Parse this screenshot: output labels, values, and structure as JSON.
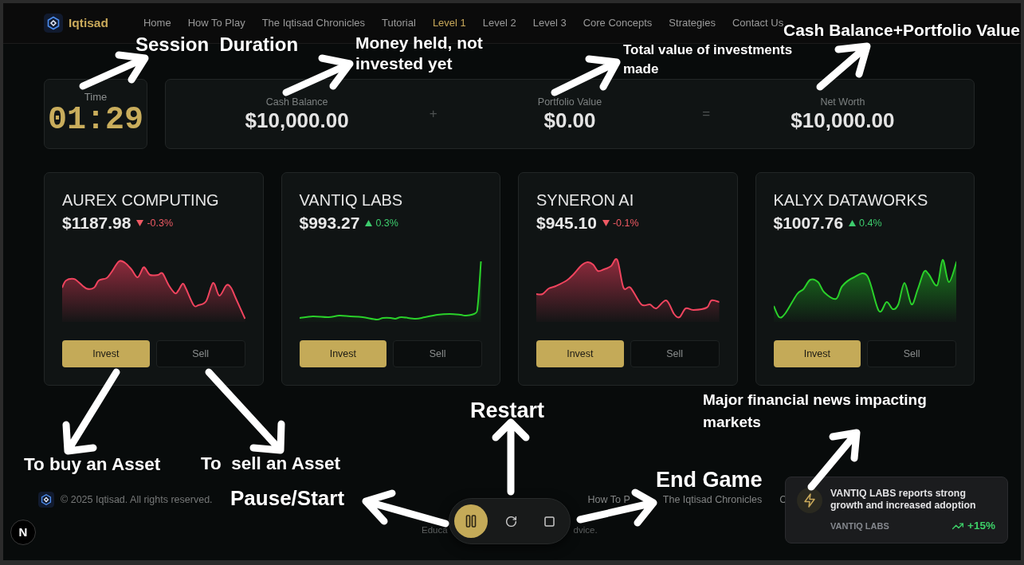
{
  "navbar": {
    "brand": "Iqtisad",
    "links": [
      {
        "label": "Home",
        "selected": false
      },
      {
        "label": "How To Play",
        "selected": false
      },
      {
        "label": "The Iqtisad Chronicles",
        "selected": false
      },
      {
        "label": "Tutorial",
        "selected": false
      },
      {
        "label": "Level 1",
        "selected": true
      },
      {
        "label": "Level 2",
        "selected": false
      },
      {
        "label": "Level 3",
        "selected": false
      },
      {
        "label": "Core Concepts",
        "selected": false
      },
      {
        "label": "Strategies",
        "selected": false
      },
      {
        "label": "Contact Us",
        "selected": false
      }
    ]
  },
  "timer": {
    "label": "Time",
    "value": "01:29"
  },
  "summary": [
    {
      "kind": "metric",
      "label": "Cash Balance",
      "value": "$10,000.00"
    },
    {
      "kind": "operator",
      "symbol": "+"
    },
    {
      "kind": "metric",
      "label": "Portfolio Value",
      "value": "$0.00"
    },
    {
      "kind": "operator",
      "symbol": "="
    },
    {
      "kind": "metric",
      "label": "Net Worth",
      "value": "$10,000.00"
    }
  ],
  "stocks": [
    {
      "name": "AUREX COMPUTING",
      "price": "$1187.98",
      "change": "-0.3%",
      "rising": false,
      "invest_button": "Invest",
      "sell_button": "Sell"
    },
    {
      "name": "VANTIQ LABS",
      "price": "$993.27",
      "change": "0.3%",
      "rising": true,
      "invest_button": "Invest",
      "sell_button": "Sell"
    },
    {
      "name": "SYNERON AI",
      "price": "$945.10",
      "change": "-0.1%",
      "rising": false,
      "invest_button": "Invest",
      "sell_button": "Sell"
    },
    {
      "name": "KALYX DATAWORKS",
      "price": "$1007.76",
      "change": "0.4%",
      "rising": true,
      "invest_button": "Invest",
      "sell_button": "Sell"
    }
  ],
  "footer": {
    "copyright": "© 2025 Iqtisad. All rights reserved.",
    "links": [
      "How To P",
      "The Iqtisad Chronicles",
      "C"
    ],
    "disclaimer_parts": [
      "Educa",
      "dvice."
    ]
  },
  "game_controls": {
    "running": true
  },
  "news_toast": {
    "headline": "VANTIQ LABS reports strong growth and increased adoption",
    "company": "VANTIQ LABS",
    "change": "+15%",
    "rising": true
  },
  "dev_badge": "N",
  "annotations": [
    {
      "text": "Session  Duration"
    },
    {
      "text": "Money held, not invested yet"
    },
    {
      "text": "Total value of investments made"
    },
    {
      "text": "Cash Balance+Portfolio Value"
    },
    {
      "text": "Restart"
    },
    {
      "text": "Major financial news impacting markets"
    },
    {
      "text": "To buy an Asset"
    },
    {
      "text": "To  sell an Asset"
    },
    {
      "text": "Pause/Start"
    },
    {
      "text": "End Game"
    }
  ]
}
